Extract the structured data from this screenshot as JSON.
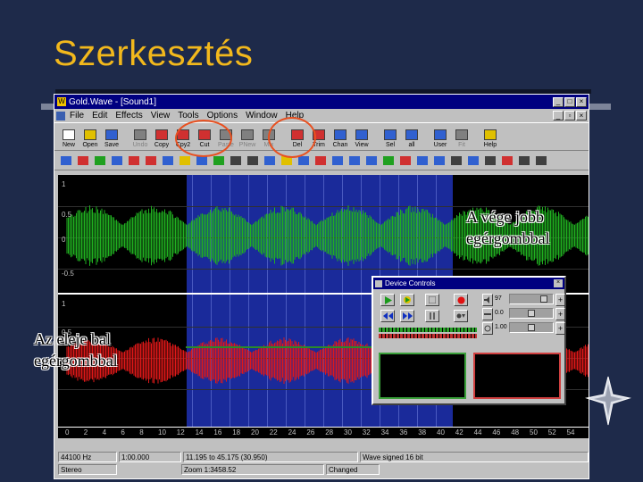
{
  "slide": {
    "title": "Szerkesztés",
    "annotation_right": [
      "A vége jobb",
      "egérgombbal"
    ],
    "annotation_left": [
      "Az eleje bal",
      "egérgombbal"
    ],
    "colors": {
      "title": "#f2b81c",
      "background": "#1e2a4a",
      "circle": "#e85020"
    }
  },
  "app": {
    "title": "Gold.Wave - [Sound1]",
    "menu": [
      "File",
      "Edit",
      "Effects",
      "View",
      "Tools",
      "Options",
      "Window",
      "Help"
    ],
    "toolbar": [
      {
        "label": "New",
        "icon": "new-file-icon"
      },
      {
        "label": "Open",
        "icon": "open-folder-icon"
      },
      {
        "label": "Save",
        "icon": "save-disk-icon"
      },
      {
        "label": "Undo",
        "icon": "undo-icon"
      },
      {
        "label": "Copy",
        "icon": "copy-icon"
      },
      {
        "label": "Cpy2",
        "icon": "copy2-icon"
      },
      {
        "label": "Cut",
        "icon": "cut-icon"
      },
      {
        "label": "Paste",
        "icon": "paste-icon"
      },
      {
        "label": "PNew",
        "icon": "paste-new-icon"
      },
      {
        "label": "Mix",
        "icon": "mix-icon"
      },
      {
        "label": "Del",
        "icon": "delete-icon"
      },
      {
        "label": "Trim",
        "icon": "trim-icon"
      },
      {
        "label": "Chan",
        "icon": "channel-icon"
      },
      {
        "label": "View",
        "icon": "view-icon"
      },
      {
        "label": "Sel",
        "icon": "select-icon"
      },
      {
        "label": "all",
        "icon": "select-all-icon"
      },
      {
        "label": "User",
        "icon": "user-icon"
      },
      {
        "label": "Fit",
        "icon": "fit-icon"
      },
      {
        "label": "Help",
        "icon": "help-icon"
      }
    ],
    "scale_top": [
      "1",
      "0.5",
      "0",
      "-0.5"
    ],
    "scale_bottom": [
      "1",
      "0.5",
      "0"
    ],
    "timeline": [
      "0",
      "2",
      "4",
      "6",
      "8",
      "10",
      "12",
      "14",
      "16",
      "18",
      "20",
      "22",
      "24",
      "26",
      "28",
      "30",
      "32",
      "34",
      "36",
      "38",
      "40",
      "42",
      "44",
      "46",
      "48",
      "50",
      "52",
      "54"
    ],
    "status": {
      "rate": "44100 Hz",
      "mode": "Stereo",
      "length": "1:00.000",
      "selection": "11.195 to 45.175 (30.950)",
      "zoom": "Zoom 1:3458.52",
      "format": "Wave signed 16 bit",
      "changed": "Changed"
    },
    "device": {
      "title": "Device Controls",
      "vol": "97",
      "bal": "0.0",
      "speed": "1.00"
    }
  }
}
